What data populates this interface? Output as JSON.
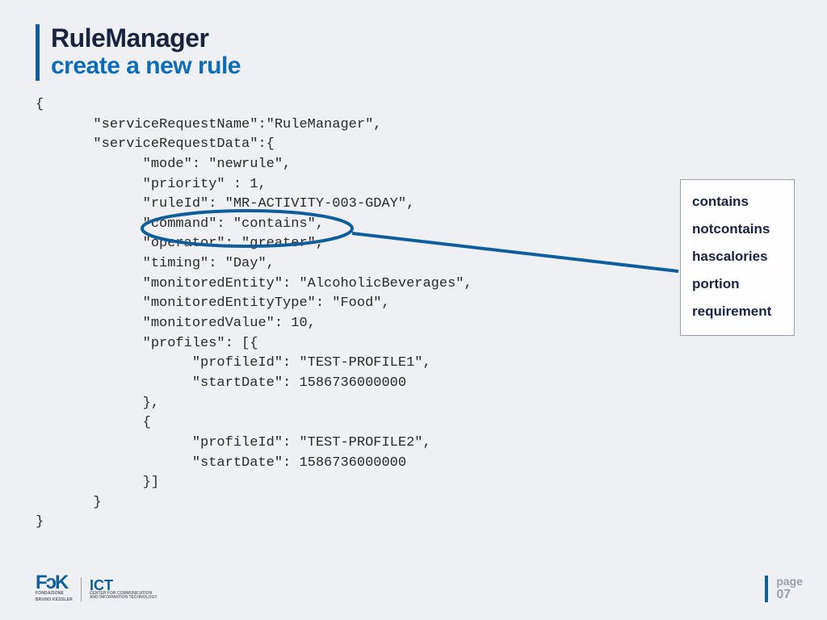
{
  "title": {
    "main": "RuleManager",
    "sub": "create a new rule"
  },
  "code": "{\n       \"serviceRequestName\":\"RuleManager\",\n       \"serviceRequestData\":{\n             \"mode\": \"newrule\",\n             \"priority\" : 1,\n             \"ruleId\": \"MR-ACTIVITY-003-GDAY\",\n             \"command\": \"contains\",\n             \"operator\": \"greater\",\n             \"timing\": \"Day\",\n             \"monitoredEntity\": \"AlcoholicBeverages\",\n             \"monitoredEntityType\": \"Food\",\n             \"monitoredValue\": 10,\n             \"profiles\": [{\n                   \"profileId\": \"TEST-PROFILE1\",\n                   \"startDate\": 1586736000000\n             },\n             {\n                   \"profileId\": \"TEST-PROFILE2\",\n                   \"startDate\": 1586736000000\n             }]\n       }\n}",
  "options": {
    "items": [
      "contains",
      "notcontains",
      "hascalories",
      "portion",
      "requirement"
    ]
  },
  "logo": {
    "glyph": "FɔK",
    "org1": "FONDAZIONE",
    "org2": "BRUNO KESSLER",
    "unit": "ICT",
    "unit_tag1": "CENTER FOR COMMUNICATION",
    "unit_tag2": "AND INFORMATION TECHNOLOGY"
  },
  "page": {
    "label": "page",
    "num": "07"
  }
}
